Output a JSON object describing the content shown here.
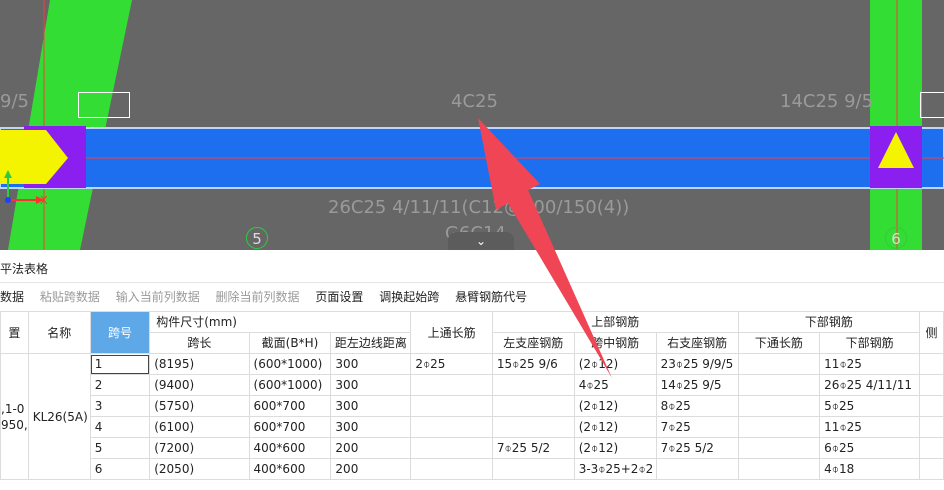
{
  "canvas": {
    "labels": {
      "left_top": "9/5",
      "center_top": "4C25",
      "right_top": "14C25 9/5",
      "bottom_main": "26C25 4/11/11(C12@100/150(4))",
      "bottom_sub": "G6C14"
    },
    "axis_left": "5",
    "axis_right": "6",
    "axis_x_label": "X",
    "collapse_glyph": "⌄"
  },
  "panel": {
    "title": "平法表格"
  },
  "toolbar": {
    "items": [
      {
        "label": "数据",
        "enabled": true
      },
      {
        "label": "粘贴跨数据",
        "enabled": false
      },
      {
        "label": "输入当前列数据",
        "enabled": false
      },
      {
        "label": "删除当前列数据",
        "enabled": false
      },
      {
        "label": "页面设置",
        "enabled": true
      },
      {
        "label": "调换起始跨",
        "enabled": true
      },
      {
        "label": "悬臂钢筋代号",
        "enabled": true
      }
    ]
  },
  "table": {
    "headers": {
      "position": "置",
      "name": "名称",
      "span_no": "跨号",
      "member_size": "构件尺寸(mm)",
      "span_len": "跨长",
      "section": "截面(B*H)",
      "dist_left": "距左边线距离",
      "top_long": "上通长筋",
      "top_steel": "上部钢筋",
      "left_support": "左支座钢筋",
      "mid_span": "跨中钢筋",
      "right_support": "右支座钢筋",
      "bottom_steel": "下部钢筋",
      "bottom_long": "下通长筋",
      "bottom_bars": "下部钢筋",
      "side": "侧"
    },
    "left_stub": {
      "line1": ",1-0",
      "line2": "950,",
      "name": "KL26(5A)"
    },
    "rows": [
      {
        "no": "1",
        "len": "(8195)",
        "sec": "(600*1000)",
        "dist": "300",
        "top_long": "2⌽25",
        "left": "15⌽25 9/6",
        "mid": "(2⌽12)",
        "right": "23⌽25 9/9/5",
        "bot_long": "",
        "bot": "11⌽25"
      },
      {
        "no": "2",
        "len": "(9400)",
        "sec": "(600*1000)",
        "dist": "300",
        "top_long": "",
        "left": "",
        "mid": "4⌽25",
        "right": "14⌽25 9/5",
        "bot_long": "",
        "bot": "26⌽25 4/11/11"
      },
      {
        "no": "3",
        "len": "(5750)",
        "sec": "600*700",
        "dist": "300",
        "top_long": "",
        "left": "",
        "mid": "(2⌽12)",
        "right": "8⌽25",
        "bot_long": "",
        "bot": "5⌽25"
      },
      {
        "no": "4",
        "len": "(6100)",
        "sec": "600*700",
        "dist": "300",
        "top_long": "",
        "left": "",
        "mid": "(2⌽12)",
        "right": "7⌽25",
        "bot_long": "",
        "bot": "11⌽25"
      },
      {
        "no": "5",
        "len": "(7200)",
        "sec": "400*600",
        "dist": "200",
        "top_long": "",
        "left": "7⌽25 5/2",
        "mid": "(2⌽12)",
        "right": "7⌽25 5/2",
        "bot_long": "",
        "bot": "6⌽25"
      },
      {
        "no": "6",
        "len": "(2050)",
        "sec": "400*600",
        "dist": "200",
        "top_long": "",
        "left": "",
        "mid": "3-3⌽25+2⌽2",
        "right": "",
        "bot_long": "",
        "bot": "4⌽18"
      }
    ]
  },
  "colors": {
    "canvas_bg": "#666666",
    "beam": "#1e6ff0",
    "column": "#33dd33",
    "support": "#8a1ff0",
    "marker": "#f4f400",
    "arrow": "#f04555",
    "selected_header": "#5fa8e8"
  }
}
